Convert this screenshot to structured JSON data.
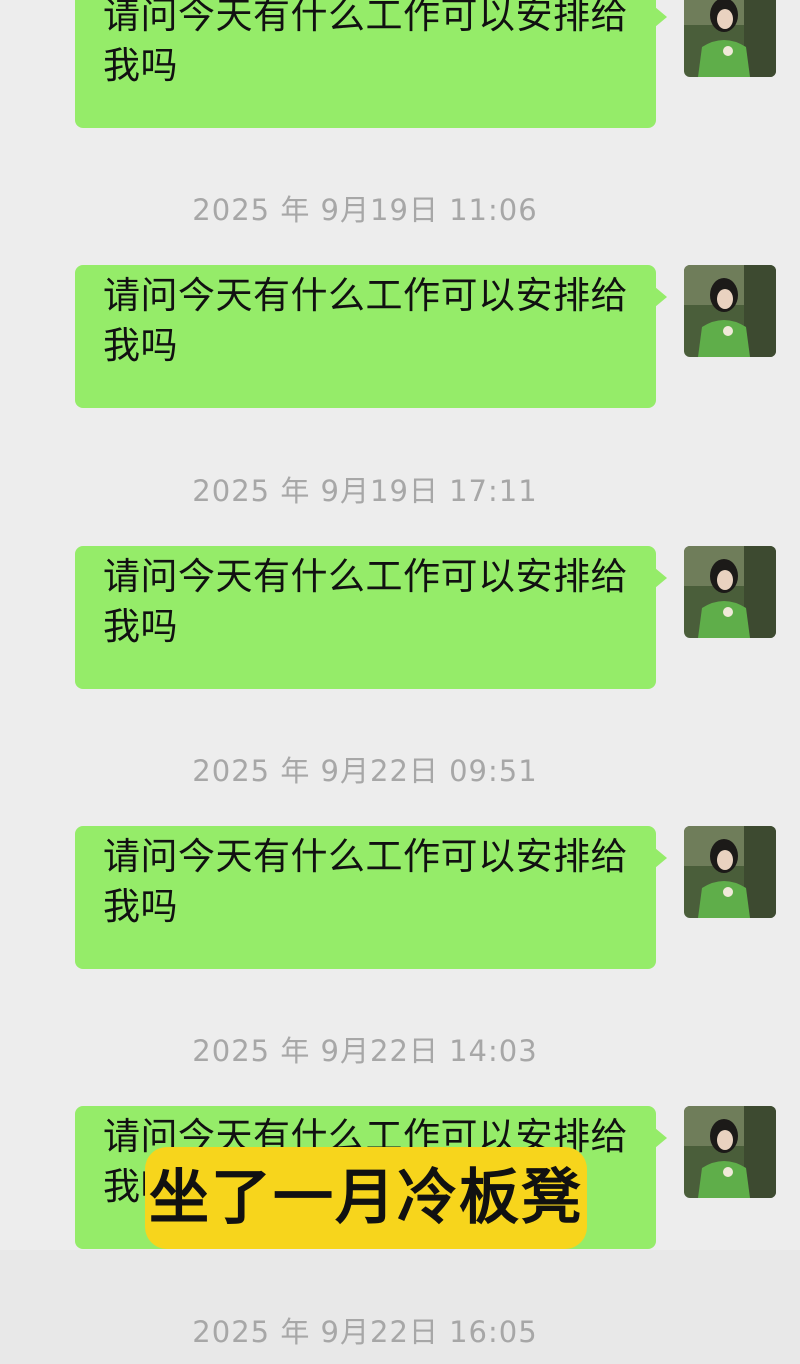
{
  "chat": {
    "messages": [
      {
        "text": "请问今天有什么工作可以安排给我吗"
      },
      {
        "text": "请问今天有什么工作可以安排给我吗"
      },
      {
        "text": "请问今天有什么工作可以安排给我吗"
      },
      {
        "text": "请问今天有什么工作可以安排给我吗"
      },
      {
        "text": "请问今天有什么工作可以安排给我吗"
      }
    ],
    "timestamps": [
      "2025 年 9月19日 11:06",
      "2025 年 9月19日 17:11",
      "2025 年 9月22日 09:51",
      "2025 年 9月22日 14:03",
      "2025 年 9月22日 16:05"
    ]
  },
  "caption": {
    "text": "坐了一月冷板凳"
  },
  "colors": {
    "background": "#ededed",
    "bubble": "#95ec69",
    "timestamp": "#a7a7a7",
    "caption_bg": "#f7d51c"
  },
  "icons": {
    "avatar": "user-avatar-photo"
  }
}
